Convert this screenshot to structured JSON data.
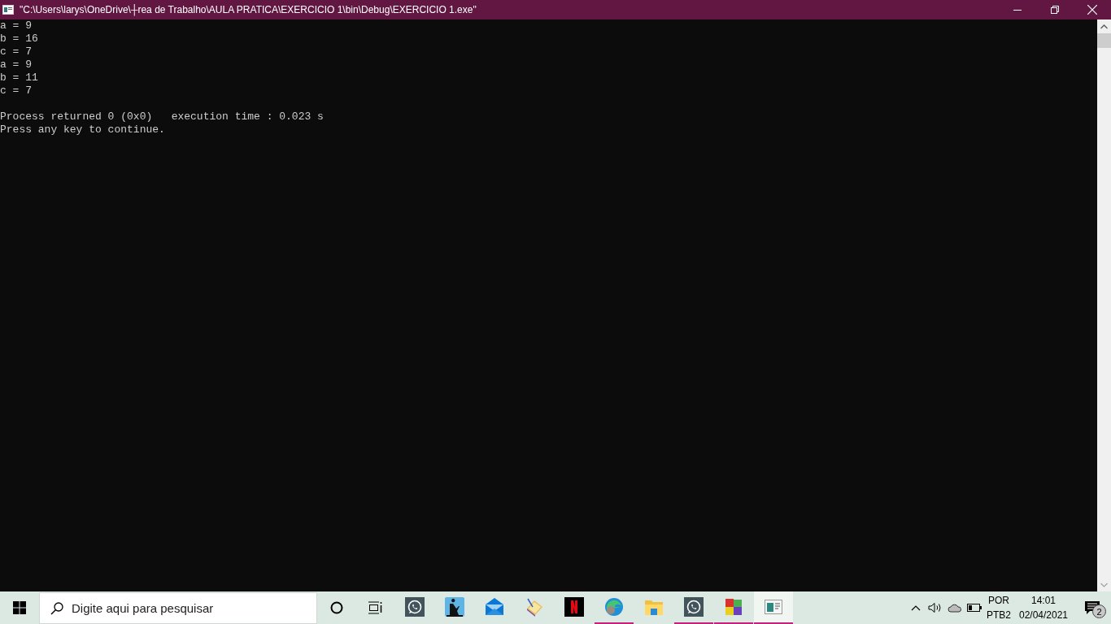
{
  "window": {
    "title": "\"C:\\Users\\larys\\OneDrive\\┼rea de Trabalho\\AULA PRATICA\\EXERCICIO 1\\bin\\Debug\\EXERCICIO 1.exe\""
  },
  "console": {
    "output_lines": [
      "a = 9",
      "b = 16",
      "c = 7",
      "a = 9",
      "b = 11",
      "c = 7"
    ],
    "status_lines": [
      "Process returned 0 (0x0)   execution time : 0.023 s",
      "Press any key to continue."
    ]
  },
  "taskbar": {
    "search": {
      "placeholder": "Digite aqui para pesquisar"
    },
    "apps": [
      {
        "kind": "chat",
        "running": false,
        "selected": false
      },
      {
        "kind": "reader",
        "running": false,
        "selected": false
      },
      {
        "kind": "mail",
        "running": false,
        "selected": false
      },
      {
        "kind": "scanner",
        "running": false,
        "selected": false
      },
      {
        "kind": "letter",
        "running": false,
        "selected": false
      },
      {
        "kind": "browser",
        "running": true,
        "selected": false
      },
      {
        "kind": "folder",
        "running": false,
        "selected": false
      },
      {
        "kind": "chat",
        "running": true,
        "selected": false
      },
      {
        "kind": "tiles",
        "running": true,
        "selected": false
      },
      {
        "kind": "console",
        "running": true,
        "selected": true
      }
    ],
    "tray": {
      "language": "POR",
      "layout": "PTB2",
      "time": "14:01",
      "date": "02/04/2021",
      "notifications": "2"
    }
  }
}
